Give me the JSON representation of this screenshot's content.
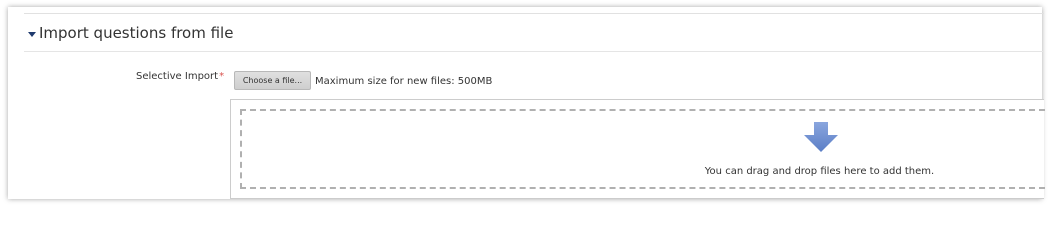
{
  "section": {
    "title": "Import questions from file"
  },
  "field": {
    "label": "Selective Import",
    "required_mark": "*"
  },
  "filepicker": {
    "choose_label": "Choose a file...",
    "max_size_text": "Maximum size for new files: 500MB"
  },
  "dropzone": {
    "text": "You can drag and drop files here to add them.",
    "icon": "arrow-down-icon"
  },
  "colors": {
    "caret": "#1f3a6e",
    "required": "#d9534f",
    "arrow": "#6f8fd0"
  }
}
